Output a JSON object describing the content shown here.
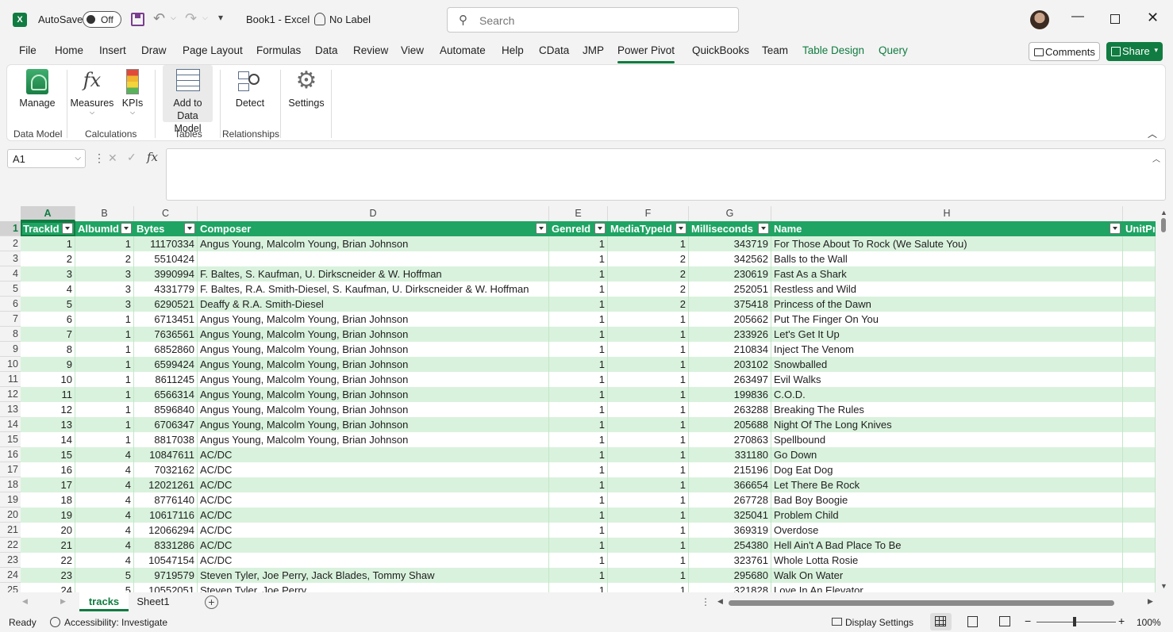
{
  "titlebar": {
    "app_glyph": "X",
    "autosave_label": "AutoSave",
    "autosave_state": "Off",
    "doc_title": "Book1  -  Excel",
    "sensitivity": "No Label",
    "search_placeholder": "Search"
  },
  "tabs": [
    "File",
    "Home",
    "Insert",
    "Draw",
    "Page Layout",
    "Formulas",
    "Data",
    "Review",
    "View",
    "Automate",
    "Help",
    "CData",
    "JMP",
    "Power Pivot",
    "QuickBooks",
    "Team",
    "Table Design",
    "Query"
  ],
  "active_tab": "Power Pivot",
  "header_buttons": {
    "comments": "Comments",
    "share": "Share"
  },
  "ribbon": {
    "manage": "Manage",
    "measures": "Measures",
    "kpis": "KPIs",
    "add_to_data_model_1": "Add to",
    "add_to_data_model_2": "Data Model",
    "detect": "Detect",
    "settings": "Settings",
    "groups": {
      "data_model": "Data Model",
      "calculations": "Calculations",
      "tables": "Tables",
      "relationships": "Relationships"
    }
  },
  "formula_bar": {
    "name_box": "A1",
    "formula": ""
  },
  "grid": {
    "col_letters": [
      "A",
      "B",
      "C",
      "D",
      "E",
      "F",
      "G",
      "H"
    ],
    "headers": [
      "TrackId",
      "AlbumId",
      "Bytes",
      "Composer",
      "GenreId",
      "MediaTypeId",
      "Milliseconds",
      "Name",
      "UnitPr"
    ],
    "row_numbers": [
      "1",
      "2",
      "3",
      "4",
      "5",
      "6",
      "7",
      "8",
      "9",
      "10",
      "11",
      "12",
      "13",
      "14",
      "15",
      "16",
      "17",
      "18",
      "19",
      "20",
      "21",
      "22",
      "23",
      "24",
      "25"
    ],
    "rows": [
      [
        "1",
        "1",
        "11170334",
        "Angus Young, Malcolm Young, Brian Johnson",
        "1",
        "1",
        "343719",
        "For Those About To Rock (We Salute You)"
      ],
      [
        "2",
        "2",
        "5510424",
        "",
        "1",
        "2",
        "342562",
        "Balls to the Wall"
      ],
      [
        "3",
        "3",
        "3990994",
        "F. Baltes, S. Kaufman, U. Dirkscneider & W. Hoffman",
        "1",
        "2",
        "230619",
        "Fast As a Shark"
      ],
      [
        "4",
        "3",
        "4331779",
        "F. Baltes, R.A. Smith-Diesel, S. Kaufman, U. Dirkscneider & W. Hoffman",
        "1",
        "2",
        "252051",
        "Restless and Wild"
      ],
      [
        "5",
        "3",
        "6290521",
        "Deaffy & R.A. Smith-Diesel",
        "1",
        "2",
        "375418",
        "Princess of the Dawn"
      ],
      [
        "6",
        "1",
        "6713451",
        "Angus Young, Malcolm Young, Brian Johnson",
        "1",
        "1",
        "205662",
        "Put The Finger On You"
      ],
      [
        "7",
        "1",
        "7636561",
        "Angus Young, Malcolm Young, Brian Johnson",
        "1",
        "1",
        "233926",
        "Let's Get It Up"
      ],
      [
        "8",
        "1",
        "6852860",
        "Angus Young, Malcolm Young, Brian Johnson",
        "1",
        "1",
        "210834",
        "Inject The Venom"
      ],
      [
        "9",
        "1",
        "6599424",
        "Angus Young, Malcolm Young, Brian Johnson",
        "1",
        "1",
        "203102",
        "Snowballed"
      ],
      [
        "10",
        "1",
        "8611245",
        "Angus Young, Malcolm Young, Brian Johnson",
        "1",
        "1",
        "263497",
        "Evil Walks"
      ],
      [
        "11",
        "1",
        "6566314",
        "Angus Young, Malcolm Young, Brian Johnson",
        "1",
        "1",
        "199836",
        "C.O.D."
      ],
      [
        "12",
        "1",
        "8596840",
        "Angus Young, Malcolm Young, Brian Johnson",
        "1",
        "1",
        "263288",
        "Breaking The Rules"
      ],
      [
        "13",
        "1",
        "6706347",
        "Angus Young, Malcolm Young, Brian Johnson",
        "1",
        "1",
        "205688",
        "Night Of The Long Knives"
      ],
      [
        "14",
        "1",
        "8817038",
        "Angus Young, Malcolm Young, Brian Johnson",
        "1",
        "1",
        "270863",
        "Spellbound"
      ],
      [
        "15",
        "4",
        "10847611",
        "AC/DC",
        "1",
        "1",
        "331180",
        "Go Down"
      ],
      [
        "16",
        "4",
        "7032162",
        "AC/DC",
        "1",
        "1",
        "215196",
        "Dog Eat Dog"
      ],
      [
        "17",
        "4",
        "12021261",
        "AC/DC",
        "1",
        "1",
        "366654",
        "Let There Be Rock"
      ],
      [
        "18",
        "4",
        "8776140",
        "AC/DC",
        "1",
        "1",
        "267728",
        "Bad Boy Boogie"
      ],
      [
        "19",
        "4",
        "10617116",
        "AC/DC",
        "1",
        "1",
        "325041",
        "Problem Child"
      ],
      [
        "20",
        "4",
        "12066294",
        "AC/DC",
        "1",
        "1",
        "369319",
        "Overdose"
      ],
      [
        "21",
        "4",
        "8331286",
        "AC/DC",
        "1",
        "1",
        "254380",
        "Hell Ain't A Bad Place To Be"
      ],
      [
        "22",
        "4",
        "10547154",
        "AC/DC",
        "1",
        "1",
        "323761",
        "Whole Lotta Rosie"
      ],
      [
        "23",
        "5",
        "9719579",
        "Steven Tyler, Joe Perry, Jack Blades, Tommy Shaw",
        "1",
        "1",
        "295680",
        "Walk On Water"
      ],
      [
        "24",
        "5",
        "10552051",
        "Steven Tyler, Joe Perry",
        "1",
        "1",
        "321828",
        "Love In An Elevator"
      ]
    ]
  },
  "sheets": [
    "tracks",
    "Sheet1"
  ],
  "active_sheet": "tracks",
  "status": {
    "ready": "Ready",
    "accessibility": "Accessibility: Investigate",
    "display_settings": "Display Settings",
    "zoom": "100%"
  },
  "colors": {
    "accent": "#107c41",
    "table_header": "#1fa463",
    "band": "#d9f2dd"
  }
}
